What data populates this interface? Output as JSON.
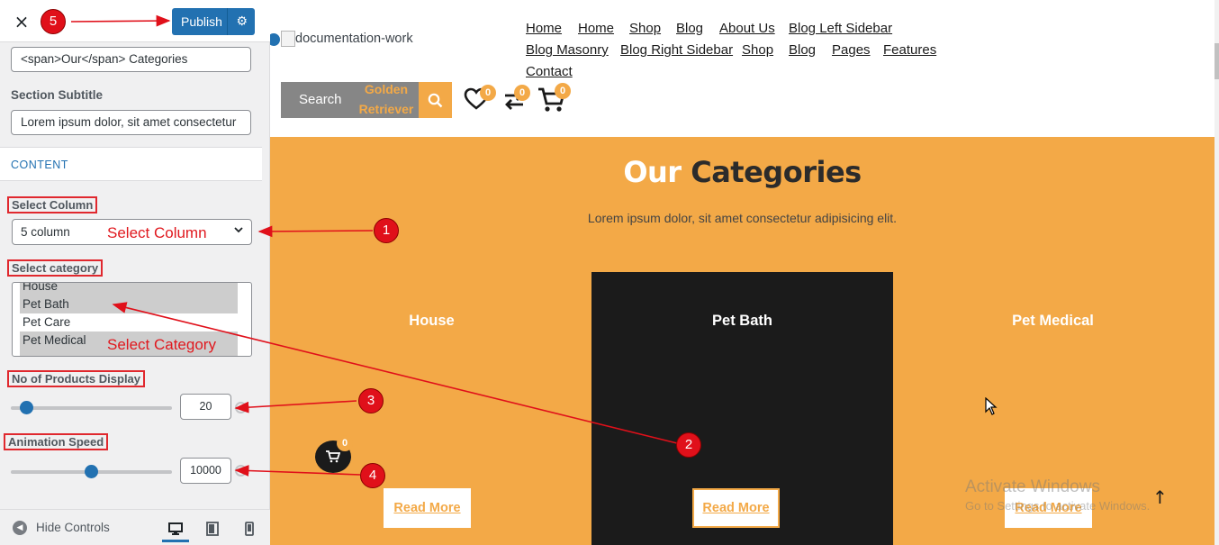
{
  "sidebar": {
    "close_icon": "×",
    "publish_label": "Publish",
    "settings_icon": "⚙",
    "section_title_value": "<span>Our</span> Categories",
    "section_subtitle_label": "Section Subtitle",
    "section_subtitle_value": "Lorem ipsum dolor, sit amet consectetur",
    "content_heading": "CONTENT",
    "select_column_label": "Select Column",
    "select_column_value": "5 column",
    "select_category_label": "Select category",
    "category_options": [
      {
        "label": "House",
        "selected": true
      },
      {
        "label": "Pet Bath",
        "selected": true
      },
      {
        "label": "Pet Care",
        "selected": false
      },
      {
        "label": "Pet Medical",
        "selected": true
      }
    ],
    "products_display_label": "No of Products Display",
    "products_display_value": "20",
    "products_display_level": 0.06,
    "animation_speed_label": "Animation Speed",
    "animation_speed_value": "10000",
    "animation_speed_level": 0.5,
    "hide_controls_label": "Hide Controls"
  },
  "annotations": {
    "select_column_note": "Select Column",
    "select_category_note": "Select Category",
    "markers": [
      "1",
      "2",
      "3",
      "4",
      "5"
    ],
    "color": "#e0101a"
  },
  "preview": {
    "logo_alt": "documentation-work",
    "nav_row1": [
      "Home",
      "Home",
      "Shop",
      "Blog",
      "About Us",
      "Blog Left Sidebar"
    ],
    "nav_row2": [
      "Blog Masonry",
      "Blog Right Sidebar",
      "Shop",
      "Blog",
      "Pages",
      "Features"
    ],
    "nav_row3": [
      "Contact"
    ],
    "search_label": "Search",
    "search_categories": [
      "Golden",
      "Retriever"
    ],
    "wishlist_count": "0",
    "compare_count": "0",
    "cart_count": "0",
    "section_title_accent": "Our",
    "section_title_rest": "Categories",
    "section_subtitle": "Lorem ipsum dolor, sit amet consectetur adipisicing elit.",
    "categories": [
      "House",
      "Pet Bath",
      "Pet Medical"
    ],
    "read_more": "Read More",
    "float_cart_count": "0",
    "activate_line1": "Activate Windows",
    "activate_line2": "Go to Settings to activate Windows.",
    "to_top_icon": "↑",
    "accent_color": "#f3a947",
    "dark_card_color": "#1b1b1b"
  }
}
